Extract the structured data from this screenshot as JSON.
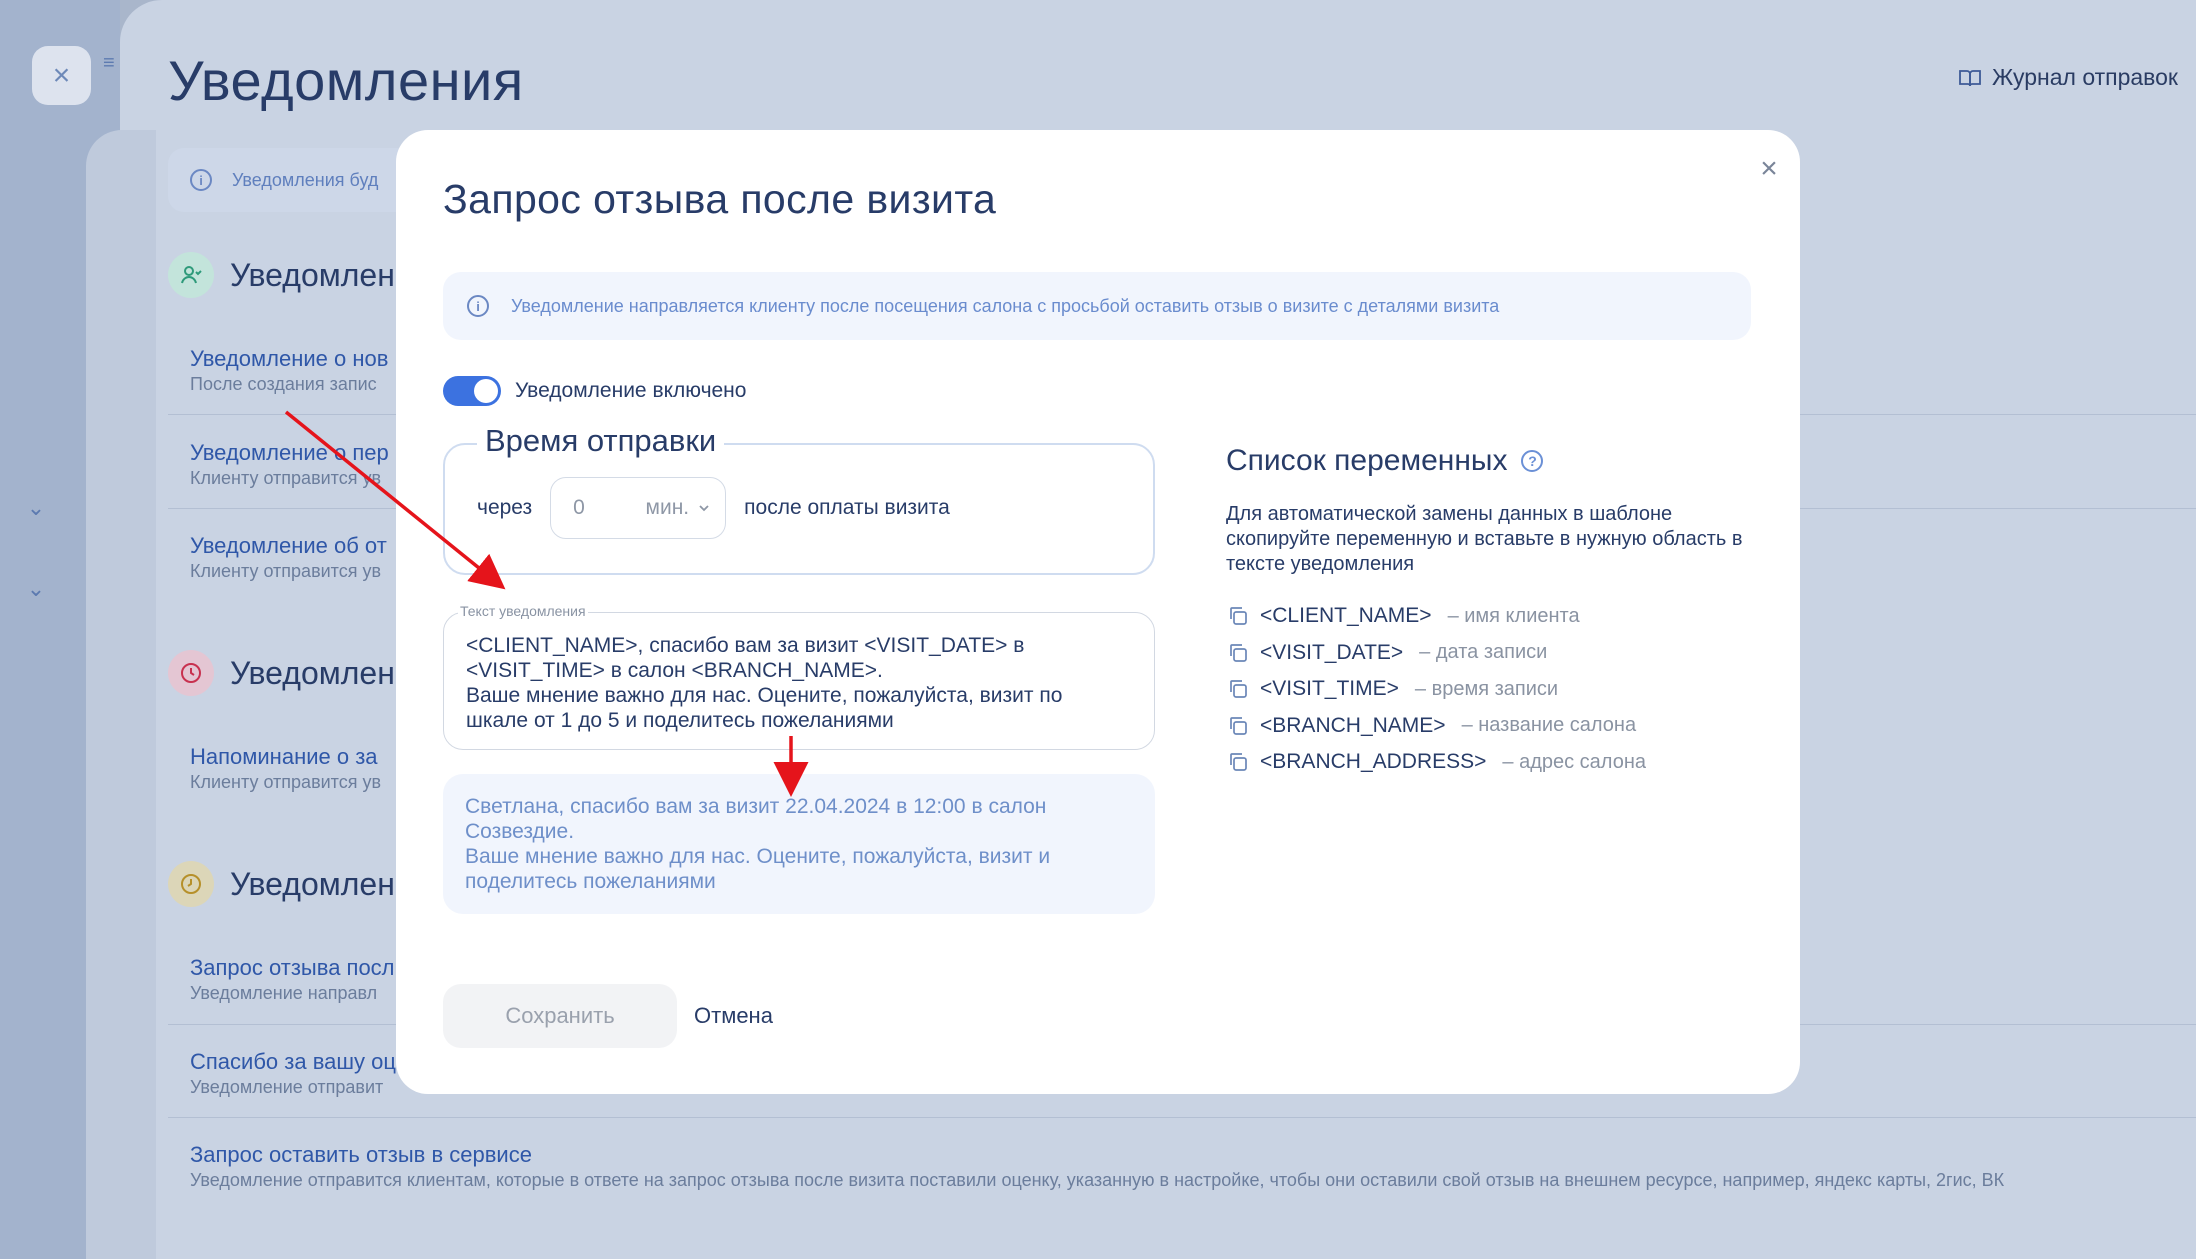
{
  "page": {
    "title": "Уведомления",
    "journal_label": "Журнал отправок",
    "info_text": "Уведомления буд",
    "sections": [
      {
        "title": "Уведомлен",
        "rows": [
          {
            "title": "Уведомление о нов",
            "sub": "После создания запис"
          },
          {
            "title": "Уведомление о пер",
            "sub": "Клиенту отправится ув"
          },
          {
            "title": "Уведомление об от",
            "sub": "Клиенту отправится ув"
          }
        ]
      },
      {
        "title": "Уведомлен",
        "rows": [
          {
            "title": "Напоминание о за",
            "sub": "Клиенту отправится ув"
          }
        ]
      },
      {
        "title": "Уведомлен",
        "rows": [
          {
            "title": "Запрос отзыва посл",
            "sub": "Уведомление направл"
          },
          {
            "title": "Спасибо за вашу оц",
            "sub": "Уведомление отправит"
          },
          {
            "title": "Запрос оставить отзыв в сервисе",
            "sub": "Уведомление отправится клиентам, которые в ответе на запрос отзыва после визита поставили оценку, указанную в настройке, чтобы они оставили свой отзыв на внешнем ресурсе, например, яндекс карты, 2гис, ВК"
          }
        ]
      }
    ]
  },
  "modal": {
    "title": "Запрос отзыва после визита",
    "info_text": "Уведомление направляется клиенту после посещения салона с просьбой оставить отзыв о визите с деталями визита",
    "toggle_label": "Уведомление включено",
    "toggle_on": true,
    "send_time": {
      "legend": "Время отправки",
      "prefix": "через",
      "value": "0",
      "unit": "мин.",
      "suffix": "после оплаты визита"
    },
    "template": {
      "label": "Текст уведомления",
      "text": "<CLIENT_NAME>, спасибо вам за визит  <VISIT_DATE> в\n<VISIT_TIME> в салон <BRANCH_NAME>.\nВаше мнение важно для нас. Оцените, пожалуйста, визит по\nшкале от 1 до 5 и поделитесь пожеланиями"
    },
    "preview_text": "Светлана, спасибо вам за визит  22.04.2024 в 12:00 в салон\nСозвездие.\nВаше мнение важно для нас. Оцените, пожалуйста, визит и\nподелитесь пожеланиями",
    "save_label": "Сохранить",
    "cancel_label": "Отмена",
    "variables": {
      "title": "Список переменных",
      "description": "Для автоматической замены данных в шаблоне скопируйте переменную и вставьте в нужную область в тексте уведомления",
      "items": [
        {
          "name": "<CLIENT_NAME>",
          "desc": "– имя клиента"
        },
        {
          "name": "<VISIT_DATE>",
          "desc": "– дата записи"
        },
        {
          "name": "<VISIT_TIME>",
          "desc": "– время записи"
        },
        {
          "name": "<BRANCH_NAME>",
          "desc": "– название салона"
        },
        {
          "name": "<BRANCH_ADDRESS>",
          "desc": "– адрес салона"
        }
      ]
    }
  },
  "colors": {
    "accent": "#3c72e0",
    "title_text": "#283c68",
    "link_text": "#2f57a8",
    "annotation_arrow": "#e5141b"
  }
}
